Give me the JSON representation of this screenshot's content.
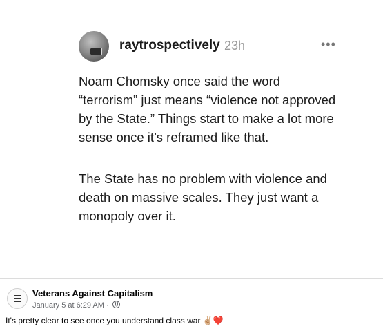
{
  "shared_post": {
    "username": "raytrospectively",
    "time": "23h",
    "more_icon": "more-horizontal-icon",
    "paragraph1": "Noam Chomsky once said the word “terrorism” just means “violence not approved by the State.” Things start to make a lot more sense once it’s reframed like that.",
    "paragraph2": "The State has no problem with violence and death on massive scales. They just want a monopoly over it."
  },
  "facebook_post": {
    "page_name": "Veterans Against Capitalism",
    "timestamp": "January 5 at 6:29 AM",
    "separator": "·",
    "audience_icon": "globe-icon",
    "caption": "It's pretty clear to see once you understand class war",
    "emoji_1": "✌🏼",
    "emoji_2": "❤️"
  },
  "colors": {
    "link_gray": "#65676b",
    "heart": "#e0243a"
  }
}
